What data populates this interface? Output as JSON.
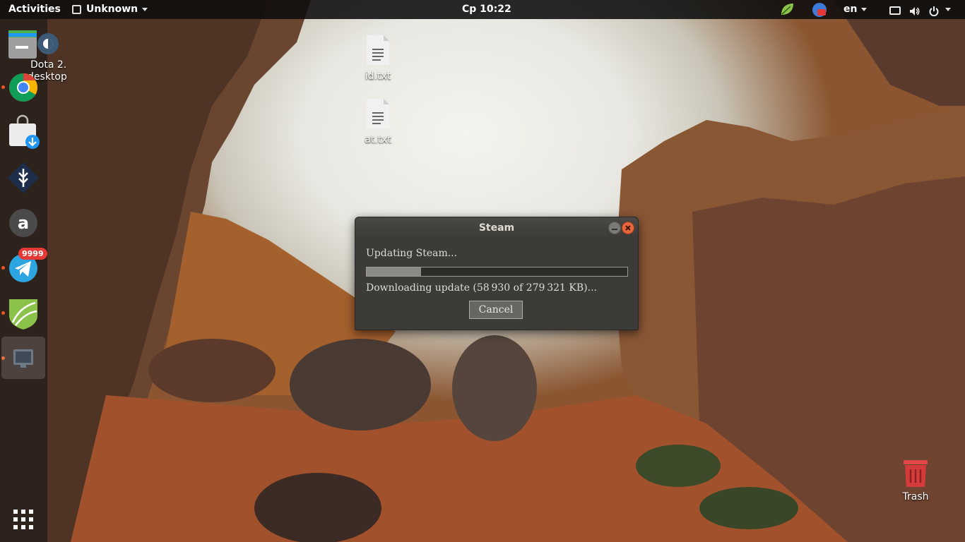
{
  "topbar": {
    "activities": "Activities",
    "app_menu": "Unknown",
    "clock": "Ср 10:22",
    "language": "en"
  },
  "dock": {
    "items": [
      {
        "name": "dota2-desktop",
        "running": false
      },
      {
        "name": "chrome",
        "running": true
      },
      {
        "name": "software-updater",
        "running": false
      },
      {
        "name": "app-shield",
        "running": false
      },
      {
        "name": "amazon",
        "running": false
      },
      {
        "name": "telegram",
        "running": true,
        "badge": "9999"
      },
      {
        "name": "leaf-app",
        "running": true
      },
      {
        "name": "screen-app",
        "running": true
      }
    ],
    "dota_label_1": "Dota 2.",
    "dota_label_2": "desktop"
  },
  "desktop": {
    "files": [
      {
        "label": "id.txt"
      },
      {
        "label": "at.txt"
      }
    ],
    "trash_label": "Trash"
  },
  "dialog": {
    "title": "Steam",
    "status": "Updating Steam...",
    "progress_fraction": 0.21,
    "detail": "Downloading update (58 930 of 279 321 KB)...",
    "cancel": "Cancel"
  },
  "colors": {
    "accent": "#e95420",
    "badge": "#e53935",
    "close_button": "#e9663c"
  }
}
